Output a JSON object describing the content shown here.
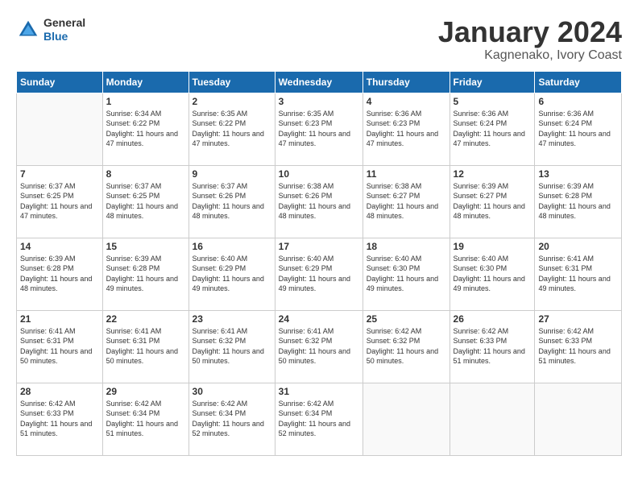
{
  "header": {
    "logo": {
      "general": "General",
      "blue": "Blue"
    },
    "title": "January 2024",
    "subtitle": "Kagnenako, Ivory Coast"
  },
  "days_of_week": [
    "Sunday",
    "Monday",
    "Tuesday",
    "Wednesday",
    "Thursday",
    "Friday",
    "Saturday"
  ],
  "weeks": [
    [
      {
        "day": "",
        "info": ""
      },
      {
        "day": "1",
        "sunrise": "Sunrise: 6:34 AM",
        "sunset": "Sunset: 6:22 PM",
        "daylight": "Daylight: 11 hours and 47 minutes."
      },
      {
        "day": "2",
        "sunrise": "Sunrise: 6:35 AM",
        "sunset": "Sunset: 6:22 PM",
        "daylight": "Daylight: 11 hours and 47 minutes."
      },
      {
        "day": "3",
        "sunrise": "Sunrise: 6:35 AM",
        "sunset": "Sunset: 6:23 PM",
        "daylight": "Daylight: 11 hours and 47 minutes."
      },
      {
        "day": "4",
        "sunrise": "Sunrise: 6:36 AM",
        "sunset": "Sunset: 6:23 PM",
        "daylight": "Daylight: 11 hours and 47 minutes."
      },
      {
        "day": "5",
        "sunrise": "Sunrise: 6:36 AM",
        "sunset": "Sunset: 6:24 PM",
        "daylight": "Daylight: 11 hours and 47 minutes."
      },
      {
        "day": "6",
        "sunrise": "Sunrise: 6:36 AM",
        "sunset": "Sunset: 6:24 PM",
        "daylight": "Daylight: 11 hours and 47 minutes."
      }
    ],
    [
      {
        "day": "7",
        "sunrise": "Sunrise: 6:37 AM",
        "sunset": "Sunset: 6:25 PM",
        "daylight": "Daylight: 11 hours and 47 minutes."
      },
      {
        "day": "8",
        "sunrise": "Sunrise: 6:37 AM",
        "sunset": "Sunset: 6:25 PM",
        "daylight": "Daylight: 11 hours and 48 minutes."
      },
      {
        "day": "9",
        "sunrise": "Sunrise: 6:37 AM",
        "sunset": "Sunset: 6:26 PM",
        "daylight": "Daylight: 11 hours and 48 minutes."
      },
      {
        "day": "10",
        "sunrise": "Sunrise: 6:38 AM",
        "sunset": "Sunset: 6:26 PM",
        "daylight": "Daylight: 11 hours and 48 minutes."
      },
      {
        "day": "11",
        "sunrise": "Sunrise: 6:38 AM",
        "sunset": "Sunset: 6:27 PM",
        "daylight": "Daylight: 11 hours and 48 minutes."
      },
      {
        "day": "12",
        "sunrise": "Sunrise: 6:39 AM",
        "sunset": "Sunset: 6:27 PM",
        "daylight": "Daylight: 11 hours and 48 minutes."
      },
      {
        "day": "13",
        "sunrise": "Sunrise: 6:39 AM",
        "sunset": "Sunset: 6:28 PM",
        "daylight": "Daylight: 11 hours and 48 minutes."
      }
    ],
    [
      {
        "day": "14",
        "sunrise": "Sunrise: 6:39 AM",
        "sunset": "Sunset: 6:28 PM",
        "daylight": "Daylight: 11 hours and 48 minutes."
      },
      {
        "day": "15",
        "sunrise": "Sunrise: 6:39 AM",
        "sunset": "Sunset: 6:28 PM",
        "daylight": "Daylight: 11 hours and 49 minutes."
      },
      {
        "day": "16",
        "sunrise": "Sunrise: 6:40 AM",
        "sunset": "Sunset: 6:29 PM",
        "daylight": "Daylight: 11 hours and 49 minutes."
      },
      {
        "day": "17",
        "sunrise": "Sunrise: 6:40 AM",
        "sunset": "Sunset: 6:29 PM",
        "daylight": "Daylight: 11 hours and 49 minutes."
      },
      {
        "day": "18",
        "sunrise": "Sunrise: 6:40 AM",
        "sunset": "Sunset: 6:30 PM",
        "daylight": "Daylight: 11 hours and 49 minutes."
      },
      {
        "day": "19",
        "sunrise": "Sunrise: 6:40 AM",
        "sunset": "Sunset: 6:30 PM",
        "daylight": "Daylight: 11 hours and 49 minutes."
      },
      {
        "day": "20",
        "sunrise": "Sunrise: 6:41 AM",
        "sunset": "Sunset: 6:31 PM",
        "daylight": "Daylight: 11 hours and 49 minutes."
      }
    ],
    [
      {
        "day": "21",
        "sunrise": "Sunrise: 6:41 AM",
        "sunset": "Sunset: 6:31 PM",
        "daylight": "Daylight: 11 hours and 50 minutes."
      },
      {
        "day": "22",
        "sunrise": "Sunrise: 6:41 AM",
        "sunset": "Sunset: 6:31 PM",
        "daylight": "Daylight: 11 hours and 50 minutes."
      },
      {
        "day": "23",
        "sunrise": "Sunrise: 6:41 AM",
        "sunset": "Sunset: 6:32 PM",
        "daylight": "Daylight: 11 hours and 50 minutes."
      },
      {
        "day": "24",
        "sunrise": "Sunrise: 6:41 AM",
        "sunset": "Sunset: 6:32 PM",
        "daylight": "Daylight: 11 hours and 50 minutes."
      },
      {
        "day": "25",
        "sunrise": "Sunrise: 6:42 AM",
        "sunset": "Sunset: 6:32 PM",
        "daylight": "Daylight: 11 hours and 50 minutes."
      },
      {
        "day": "26",
        "sunrise": "Sunrise: 6:42 AM",
        "sunset": "Sunset: 6:33 PM",
        "daylight": "Daylight: 11 hours and 51 minutes."
      },
      {
        "day": "27",
        "sunrise": "Sunrise: 6:42 AM",
        "sunset": "Sunset: 6:33 PM",
        "daylight": "Daylight: 11 hours and 51 minutes."
      }
    ],
    [
      {
        "day": "28",
        "sunrise": "Sunrise: 6:42 AM",
        "sunset": "Sunset: 6:33 PM",
        "daylight": "Daylight: 11 hours and 51 minutes."
      },
      {
        "day": "29",
        "sunrise": "Sunrise: 6:42 AM",
        "sunset": "Sunset: 6:34 PM",
        "daylight": "Daylight: 11 hours and 51 minutes."
      },
      {
        "day": "30",
        "sunrise": "Sunrise: 6:42 AM",
        "sunset": "Sunset: 6:34 PM",
        "daylight": "Daylight: 11 hours and 52 minutes."
      },
      {
        "day": "31",
        "sunrise": "Sunrise: 6:42 AM",
        "sunset": "Sunset: 6:34 PM",
        "daylight": "Daylight: 11 hours and 52 minutes."
      },
      {
        "day": "",
        "info": ""
      },
      {
        "day": "",
        "info": ""
      },
      {
        "day": "",
        "info": ""
      }
    ]
  ]
}
